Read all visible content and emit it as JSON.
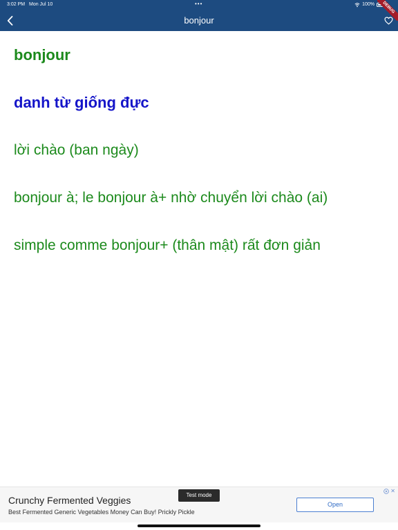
{
  "status_bar": {
    "time": "3:02 PM",
    "date": "Mon Jul 10",
    "dots": "•••",
    "battery_text": "100%"
  },
  "app_bar": {
    "title": "bonjour",
    "back_icon": "chevron-left-icon",
    "favorite_icon": "heart-outline-icon",
    "debug_label": "DEBUG",
    "background_color": "#1d4b80"
  },
  "entry": {
    "word": "bonjour",
    "part_of_speech": "danh từ giống đực",
    "meanings": [
      "lời chào (ban ngày)",
      "bonjour à; le bonjour à+ nhờ chuyển lời chào (ai)",
      "simple comme bonjour+ (thân mật) rất đơn giản"
    ],
    "word_color": "#1c8a1c",
    "pos_color": "#1515c9"
  },
  "ad": {
    "test_mode_label": "Test mode",
    "headline": "Crunchy Fermented Veggies",
    "body": "Best Fermented Generic Vegetables Money Can Buy! Prickly Pickle",
    "open_label": "Open",
    "adchoices_icon": "adchoices-icon",
    "close_label": "✕"
  }
}
